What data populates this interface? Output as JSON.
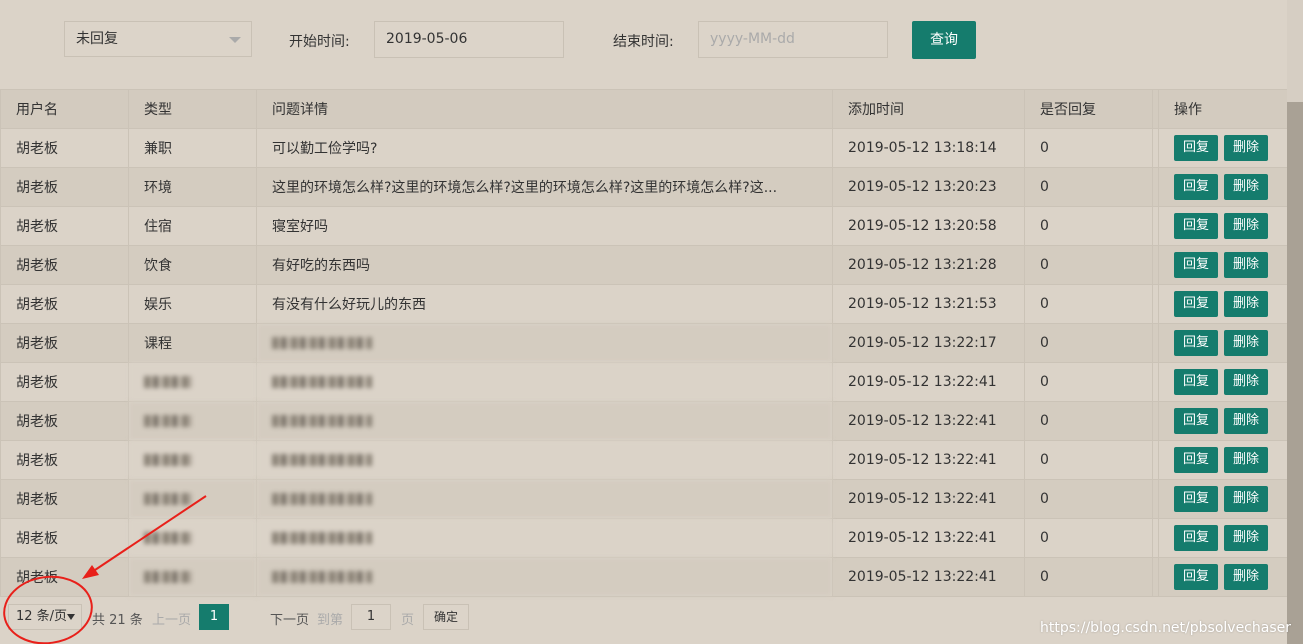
{
  "filter": {
    "status_value": "未回复",
    "start_label": "开始时间:",
    "start_value": "2019-05-06",
    "end_label": "结束时间:",
    "end_placeholder": "yyyy-MM-dd",
    "query_label": "查询"
  },
  "table": {
    "headers": [
      "用户名",
      "类型",
      "问题详情",
      "添加时间",
      "是否回复",
      "操作"
    ],
    "rows": [
      {
        "user": "胡老板",
        "type": "兼职",
        "detail": "可以勤工俭学吗?",
        "time": "2019-05-12 13:18:14",
        "replied": "0"
      },
      {
        "user": "胡老板",
        "type": "环境",
        "detail": "这里的环境怎么样?这里的环境怎么样?这里的环境怎么样?这里的环境怎么样?这...",
        "time": "2019-05-12 13:20:23",
        "replied": "0"
      },
      {
        "user": "胡老板",
        "type": "住宿",
        "detail": "寝室好吗",
        "time": "2019-05-12 13:20:58",
        "replied": "0"
      },
      {
        "user": "胡老板",
        "type": "饮食",
        "detail": "有好吃的东西吗",
        "time": "2019-05-12 13:21:28",
        "replied": "0"
      },
      {
        "user": "胡老板",
        "type": "娱乐",
        "detail": "有没有什么好玩儿的东西",
        "time": "2019-05-12 13:21:53",
        "replied": "0"
      },
      {
        "user": "胡老板",
        "type": "课程",
        "detail": "",
        "time": "2019-05-12 13:22:17",
        "replied": "0"
      },
      {
        "user": "胡老板",
        "type": "",
        "detail": "",
        "time": "2019-05-12 13:22:41",
        "replied": "0"
      },
      {
        "user": "胡老板",
        "type": "",
        "detail": "",
        "time": "2019-05-12 13:22:41",
        "replied": "0"
      },
      {
        "user": "胡老板",
        "type": "",
        "detail": "",
        "time": "2019-05-12 13:22:41",
        "replied": "0"
      },
      {
        "user": "胡老板",
        "type": "",
        "detail": "",
        "time": "2019-05-12 13:22:41",
        "replied": "0"
      },
      {
        "user": "胡老板",
        "type": "",
        "detail": "",
        "time": "2019-05-12 13:22:41",
        "replied": "0"
      },
      {
        "user": "胡老板",
        "type": "",
        "detail": "",
        "time": "2019-05-12 13:22:41",
        "replied": "0"
      }
    ],
    "reply_label": "回复",
    "delete_label": "删除"
  },
  "pager": {
    "page_size": "12 条/页",
    "total": "共 21 条",
    "prev": "上一页",
    "current": "1",
    "next": "下一页",
    "goto": "到第",
    "goto_value": "1",
    "page_unit": "页",
    "confirm": "确定"
  },
  "watermark": "https://blog.csdn.net/pbsolvechaser",
  "colors": {
    "accent": "#157c6d",
    "background": "#dbd3c8",
    "annotation": "#e8201a"
  }
}
